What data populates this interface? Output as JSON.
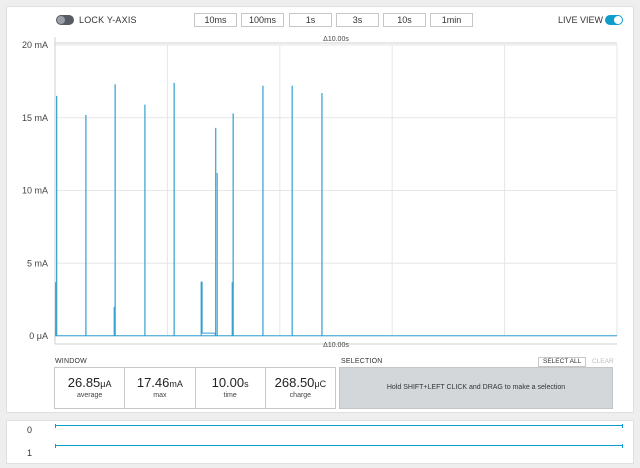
{
  "toolbar": {
    "lock_y_axis_label": "LOCK Y-AXIS",
    "live_view_label": "LIVE VIEW",
    "ranges": [
      "10ms",
      "100ms",
      "1s",
      "3s",
      "10s",
      "1min"
    ]
  },
  "chart_data": {
    "type": "line",
    "title": "",
    "xlabel": "",
    "ylabel": "",
    "window_label_top": "Δ10.00s",
    "window_label_bottom": "Δ10.00s",
    "y_ticks": [
      "20 mA",
      "15 mA",
      "10 mA",
      "5 mA",
      "0 μA"
    ],
    "y_tick_values": [
      20,
      15,
      10,
      5,
      0
    ],
    "ylim": [
      0,
      20
    ],
    "xlim": [
      0,
      10
    ],
    "grid": true,
    "series": [
      {
        "color": "#2f9fd0",
        "spikes": [
          {
            "t": 0.03,
            "peak": 16.5,
            "pre": 3.7
          },
          {
            "t": 0.55,
            "peak": 15.2
          },
          {
            "t": 1.07,
            "peak": 17.3,
            "pre": 2.0
          },
          {
            "t": 1.6,
            "peak": 15.9
          },
          {
            "t": 2.12,
            "peak": 17.4
          },
          {
            "t": 2.6,
            "peak": 3.7,
            "plateau_end": 2.85,
            "plateau": 0.2
          },
          {
            "t": 2.86,
            "peak": 14.3,
            "post": 11.2
          },
          {
            "t": 3.17,
            "peak": 15.3,
            "pre": 3.7
          },
          {
            "t": 3.7,
            "peak": 17.2
          },
          {
            "t": 4.22,
            "peak": 17.2
          },
          {
            "t": 4.75,
            "peak": 16.7
          }
        ]
      }
    ]
  },
  "window": {
    "title": "WINDOW",
    "cells": [
      {
        "value": "26.85",
        "unit": "μA",
        "label": "average"
      },
      {
        "value": "17.46",
        "unit": "mA",
        "label": "max"
      },
      {
        "value": "10.00",
        "unit": "s",
        "label": "time"
      },
      {
        "value": "268.50",
        "unit": "μC",
        "label": "charge"
      }
    ]
  },
  "selection": {
    "title": "SELECTION",
    "select_all_label": "SELECT ALL",
    "clear_label": "CLEAR",
    "hint": "Hold SHIFT+LEFT CLICK and DRAG to make a selection"
  },
  "digital": {
    "channels": [
      "0",
      "1"
    ]
  },
  "colors": {
    "accent": "#0f9dc9",
    "trace": "#2f9fd0"
  }
}
